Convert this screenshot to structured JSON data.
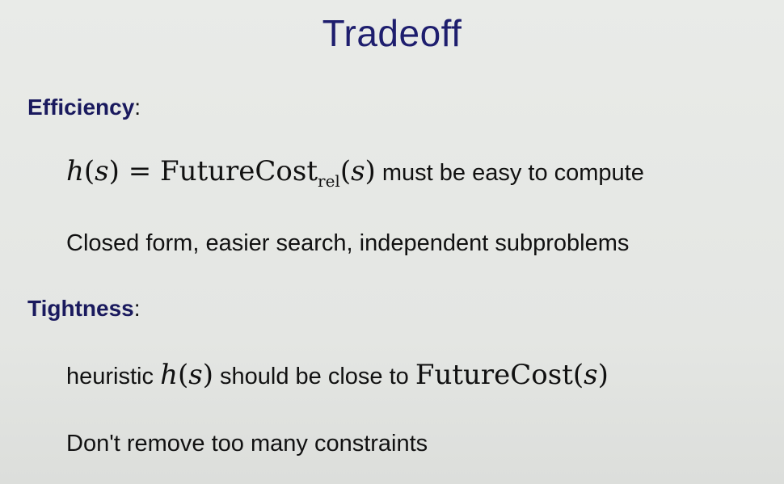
{
  "slide": {
    "title": "Tradeoff",
    "efficiency": {
      "heading": "Efficiency",
      "colon": ":",
      "formula": {
        "h": "h",
        "open": "(",
        "s": "s",
        "close": ") = FutureCost",
        "sub": "rel",
        "arg_open": "(",
        "arg_s": "s",
        "arg_close": ")"
      },
      "formula_text": "must be easy to compute",
      "detail": "Closed form, easier search, independent subproblems"
    },
    "tightness": {
      "heading": "Tightness",
      "colon": ":",
      "lead": "heuristic",
      "math_h": "h",
      "math_open": "(",
      "math_s": "s",
      "math_close": ")",
      "middle": "should be close to",
      "math_fc": "FutureCost(",
      "math_fc_s": "s",
      "math_fc_close": ")",
      "detail": "Don't remove too many constraints"
    }
  }
}
